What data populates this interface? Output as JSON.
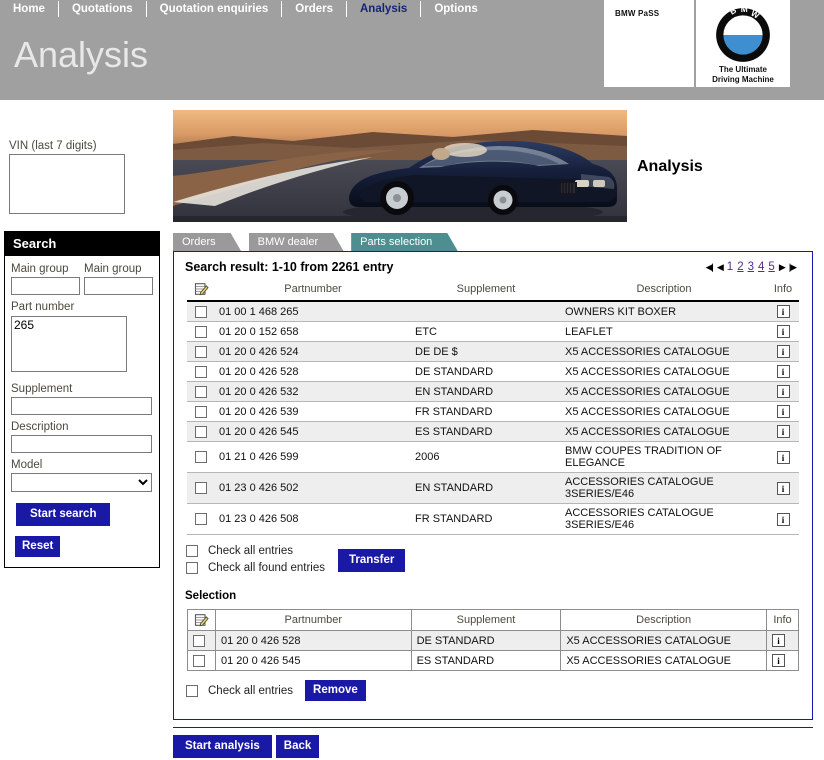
{
  "header": {
    "nav_items": [
      {
        "label": "Home",
        "active": false
      },
      {
        "label": "Quotations",
        "active": false
      },
      {
        "label": "Quotation enquiries",
        "active": false
      },
      {
        "label": "Orders",
        "active": false
      },
      {
        "label": "Analysis",
        "active": true
      },
      {
        "label": "Options",
        "active": false
      }
    ],
    "page_title": "Analysis",
    "pass_logo_text": "BMW PaSS",
    "bmw_tagline_line1": "The Ultimate",
    "bmw_tagline_line2": "Driving Machine",
    "band_color": "#a0a0a0",
    "active_nav_color": "#14247a"
  },
  "banner": {
    "alt": "BMW 3 Series convertible on a winding road",
    "side_label": "Analysis"
  },
  "sidebar": {
    "vin": {
      "label": "VIN (last 7 digits)",
      "value": "",
      "placeholder": ""
    },
    "search_panel": {
      "title": "Search",
      "main_group_1": {
        "label": "Main group",
        "value": ""
      },
      "main_group_2": {
        "label": "Main group",
        "value": ""
      },
      "part_number": {
        "label": "Part number",
        "value": "265"
      },
      "supplement": {
        "label": "Supplement",
        "value": ""
      },
      "description": {
        "label": "Description",
        "value": ""
      },
      "model": {
        "label": "Model",
        "value": "",
        "options": [
          ""
        ]
      },
      "start_search_label": "Start search",
      "reset_label": "Reset"
    }
  },
  "tabs": [
    {
      "label": "Orders",
      "active": false
    },
    {
      "label": "BMW dealer",
      "active": false
    },
    {
      "label": "Parts selection",
      "active": true
    }
  ],
  "results": {
    "title": "Search result: 1-10 from 2261 entry",
    "pager": {
      "first": "◀|",
      "prev": "◀",
      "pages": [
        "1",
        "2",
        "3",
        "4",
        "5"
      ],
      "current_page": "1",
      "next": "▶",
      "last": "|▶"
    },
    "columns": [
      "",
      "Partnumber",
      "Supplement",
      "Description",
      "Info"
    ],
    "rows": [
      {
        "partnumber": "01 00 1 468 265",
        "supplement": "",
        "description": "OWNERS KIT BOXER",
        "info": "i"
      },
      {
        "partnumber": "01 20 0 152 658",
        "supplement": "ETC",
        "description": "LEAFLET",
        "info": "i"
      },
      {
        "partnumber": "01 20 0 426 524",
        "supplement": "DE DE $",
        "description": "X5 ACCESSORIES CATALOGUE",
        "info": "i"
      },
      {
        "partnumber": "01 20 0 426 528",
        "supplement": "DE STANDARD",
        "description": "X5 ACCESSORIES CATALOGUE",
        "info": "i"
      },
      {
        "partnumber": "01 20 0 426 532",
        "supplement": "EN STANDARD",
        "description": "X5 ACCESSORIES CATALOGUE",
        "info": "i"
      },
      {
        "partnumber": "01 20 0 426 539",
        "supplement": "FR STANDARD",
        "description": "X5 ACCESSORIES CATALOGUE",
        "info": "i"
      },
      {
        "partnumber": "01 20 0 426 545",
        "supplement": "ES STANDARD",
        "description": "X5 ACCESSORIES CATALOGUE",
        "info": "i"
      },
      {
        "partnumber": "01 21 0 426 599",
        "supplement": "2006",
        "description": "BMW COUPES TRADITION OF ELEGANCE",
        "info": "i"
      },
      {
        "partnumber": "01 23 0 426 502",
        "supplement": "EN STANDARD",
        "description": "ACCESSORIES CATALOGUE 3SERIES/E46",
        "info": "i"
      },
      {
        "partnumber": "01 23 0 426 508",
        "supplement": "FR STANDARD",
        "description": "ACCESSORIES CATALOGUE 3SERIES/E46",
        "info": "i"
      }
    ],
    "check_all_entries_label": "Check all entries",
    "check_all_found_entries_label": "Check all found entries",
    "transfer_label": "Transfer"
  },
  "selection": {
    "title": "Selection",
    "columns": [
      "",
      "Partnumber",
      "Supplement",
      "Description",
      "Info"
    ],
    "rows": [
      {
        "partnumber": "01 20 0 426 528",
        "supplement": "DE STANDARD",
        "description": "X5 ACCESSORIES CATALOGUE",
        "info": "i"
      },
      {
        "partnumber": "01 20 0 426 545",
        "supplement": "ES STANDARD",
        "description": "X5 ACCESSORIES CATALOGUE",
        "info": "i"
      }
    ],
    "check_all_entries_label": "Check all entries",
    "remove_label": "Remove"
  },
  "footer": {
    "start_analysis_label": "Start analysis",
    "back_label": "Back"
  },
  "colors": {
    "accent_blue": "#1919a5",
    "active_tab_teal": "#4e8e90",
    "inactive_tab_gray": "#9a9a9a",
    "link_purple": "#5a2a8a"
  }
}
